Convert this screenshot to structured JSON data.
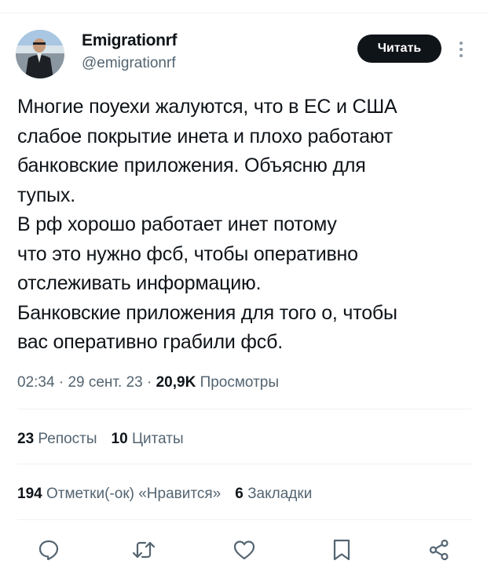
{
  "author": {
    "display_name": "Emigrationrf",
    "handle": "@emigrationrf",
    "avatar_icon": "avatar-photo"
  },
  "follow_button": {
    "label": "Читать"
  },
  "more_icon": "more-vertical-icon",
  "tweet": {
    "lines": [
      "Многие поуехи жалуются, что в ЕС и США",
      "слабое покрытие инета и плохо работают",
      "банковские приложения. Объясню для",
      "тупых.",
      "В рф хорошо работает инет потому",
      "что это нужно фсб, чтобы оперативно",
      "отслеживать информацию.",
      "Банковские приложения для того о, чтобы",
      "вас оперативно грабили фсб."
    ]
  },
  "meta": {
    "time": "02:34",
    "date": "29 сент. 23",
    "views_count": "20,9K",
    "views_label": "Просмотры"
  },
  "stats": {
    "reposts_count": "23",
    "reposts_label": "Репосты",
    "quotes_count": "10",
    "quotes_label": "Цитаты",
    "likes_count": "194",
    "likes_label": "Отметки(-ок) «Нравится»",
    "bookmarks_count": "6",
    "bookmarks_label": "Закладки"
  },
  "actions": [
    "reply-icon",
    "retweet-icon",
    "like-icon",
    "bookmark-icon",
    "share-icon"
  ],
  "colors": {
    "text": "#0f1419",
    "secondary": "#536471",
    "divider": "#eff3f4",
    "button": "#0f1419"
  }
}
